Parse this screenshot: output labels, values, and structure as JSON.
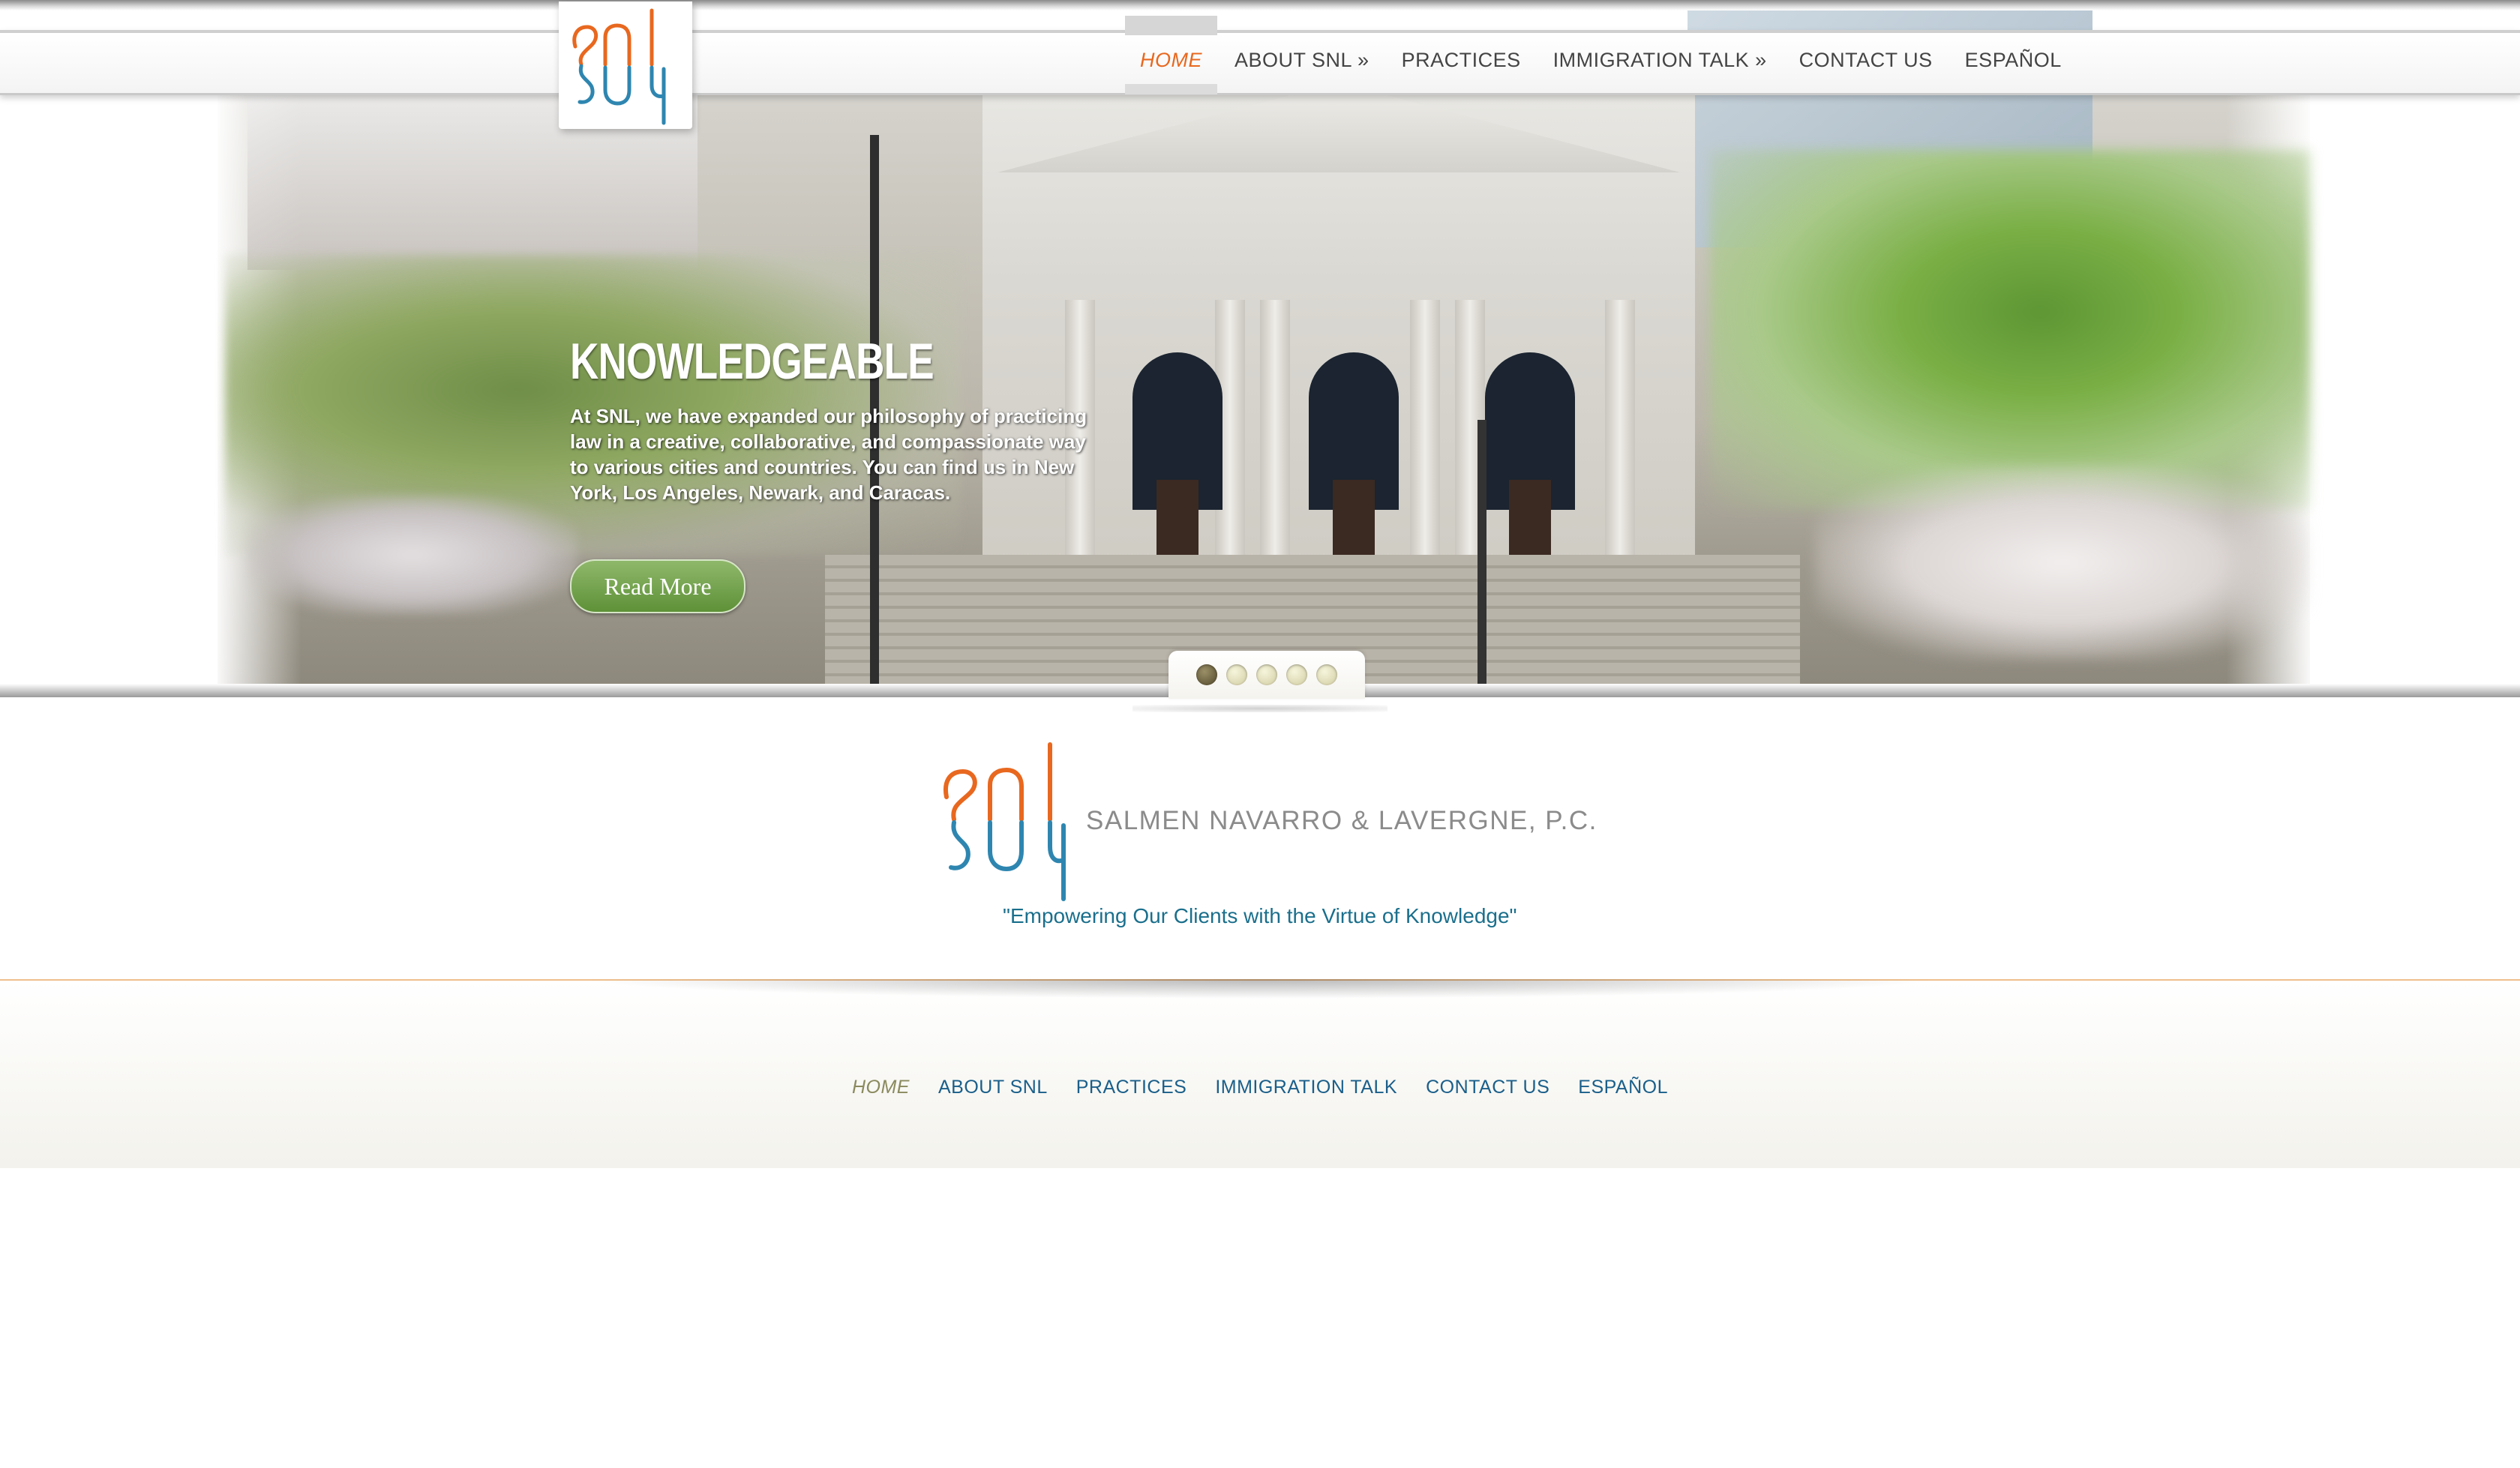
{
  "header": {
    "nav": [
      {
        "label": "HOME",
        "active": true
      },
      {
        "label": "ABOUT SNL »",
        "active": false
      },
      {
        "label": "PRACTICES",
        "active": false
      },
      {
        "label": "IMMIGRATION TALK »",
        "active": false
      },
      {
        "label": "CONTACT US",
        "active": false
      },
      {
        "label": "ESPAÑOL",
        "active": false
      }
    ]
  },
  "hero": {
    "title": "KNOWLEDGEABLE",
    "body": "At SNL, we have expanded our philosophy of practicing law in a creative, collaborative, and compassionate way to various cities and countries. You can find us in New York, Los Angeles, Newark, and Caracas.",
    "button_label": "Read More",
    "slides_count": 5,
    "active_slide": 1
  },
  "brand": {
    "logo_letters": "snl",
    "firm_name": "SALMEN NAVARRO & LAVERGNE, P.C.",
    "tagline": "\"Empowering Our Clients with the Virtue of Knowledge\""
  },
  "footer": {
    "nav": [
      {
        "label": "HOME",
        "active": true
      },
      {
        "label": "ABOUT SNL",
        "active": false
      },
      {
        "label": "PRACTICES",
        "active": false
      },
      {
        "label": "IMMIGRATION TALK",
        "active": false
      },
      {
        "label": "CONTACT US",
        "active": false
      },
      {
        "label": "ESPAÑOL",
        "active": false
      }
    ]
  },
  "colors": {
    "accent_orange": "#e8681f",
    "logo_blue": "#2e86b0",
    "tagline_blue": "#1a6f8c",
    "footer_link": "#1a5f8a",
    "button_green": "#6b9d44"
  }
}
